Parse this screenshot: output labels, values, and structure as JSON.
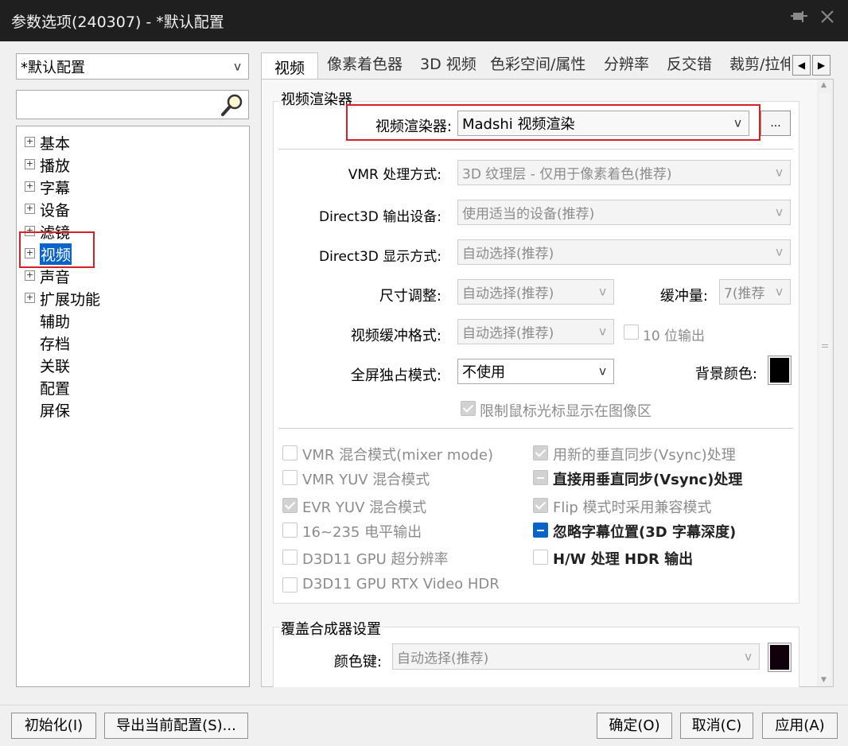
{
  "window": {
    "title": "参数选项(240307) - *默认配置",
    "pin_icon": "pin-icon",
    "close_icon": "close-icon"
  },
  "sidebar": {
    "profile_select": "*默认配置",
    "search_value": "",
    "tree": [
      {
        "label": "基本",
        "expandable": true
      },
      {
        "label": "播放",
        "expandable": true
      },
      {
        "label": "字幕",
        "expandable": true
      },
      {
        "label": "设备",
        "expandable": true
      },
      {
        "label": "滤镜",
        "expandable": true
      },
      {
        "label": "视频",
        "expandable": true,
        "selected": true
      },
      {
        "label": "声音",
        "expandable": true
      },
      {
        "label": "扩展功能",
        "expandable": true
      },
      {
        "label": "辅助",
        "expandable": false
      },
      {
        "label": "存档",
        "expandable": false
      },
      {
        "label": "关联",
        "expandable": false
      },
      {
        "label": "配置",
        "expandable": false
      },
      {
        "label": "屏保",
        "expandable": false
      }
    ]
  },
  "tabs": [
    "视频",
    "像素着色器",
    "3D 视频",
    "色彩空间/属性",
    "分辨率",
    "反交错",
    "裁剪/拉伸"
  ],
  "renderer_group": {
    "title": "视频渲染器",
    "renderer_label": "视频渲染器:",
    "renderer_value": "Madshi 视频渲染",
    "more_button": "...",
    "vmr_label": "VMR 处理方式:",
    "vmr_value": "3D 纹理层 - 仅用于像素着色(推荐)",
    "d3d_device_label": "Direct3D 输出设备:",
    "d3d_device_value": "使用适当的设备(推荐)",
    "d3d_display_label": "Direct3D 显示方式:",
    "d3d_display_value": "自动选择(推荐)",
    "resize_label": "尺寸调整:",
    "resize_value": "自动选择(推荐)",
    "buffer_label": "缓冲量:",
    "buffer_value": "7(推荐",
    "buffer_format_label": "视频缓冲格式:",
    "buffer_format_value": "自动选择(推荐)",
    "tenbit_label": "10 位输出",
    "fullscreen_label": "全屏独占模式:",
    "fullscreen_value": "不使用",
    "bg_color_label": "背景颜色:",
    "bg_color": "#000000",
    "limit_cursor_label": "限制鼠标光标显示在图像区"
  },
  "options_left": [
    {
      "label": "VMR 混合模式(mixer mode)",
      "state": "unchecked"
    },
    {
      "label": "VMR YUV 混合模式",
      "state": "unchecked"
    },
    {
      "label": "EVR YUV 混合模式",
      "state": "checked"
    },
    {
      "label": "16~235 电平输出",
      "state": "unchecked"
    },
    {
      "label": "D3D11 GPU 超分辨率",
      "state": "unchecked"
    },
    {
      "label": "D3D11 GPU RTX Video HDR",
      "state": "unchecked"
    }
  ],
  "options_right": [
    {
      "label": "用新的垂直同步(Vsync)处理",
      "state": "checked"
    },
    {
      "label": "直接用垂直同步(Vsync)处理",
      "state": "mixed"
    },
    {
      "label": "Flip 模式时采用兼容模式",
      "state": "checked"
    },
    {
      "label": "忽略字幕位置(3D 字幕深度)",
      "state": "mixed-active"
    },
    {
      "label": "H/W 处理 HDR 输出",
      "state": "unchecked"
    }
  ],
  "overlay_group": {
    "title": "覆盖合成器设置",
    "color_key_label": "颜色键:",
    "color_key_value": "自动选择(推荐)",
    "color_key_swatch": "#10000c"
  },
  "footer": {
    "reset": "初始化(I)",
    "export": "导出当前配置(S)...",
    "ok": "确定(O)",
    "cancel": "取消(C)",
    "apply": "应用(A)"
  },
  "colors": {
    "accent": "#0a64c8",
    "highlight_box": "#d61f26",
    "titlebar": "#1f1f1f"
  }
}
